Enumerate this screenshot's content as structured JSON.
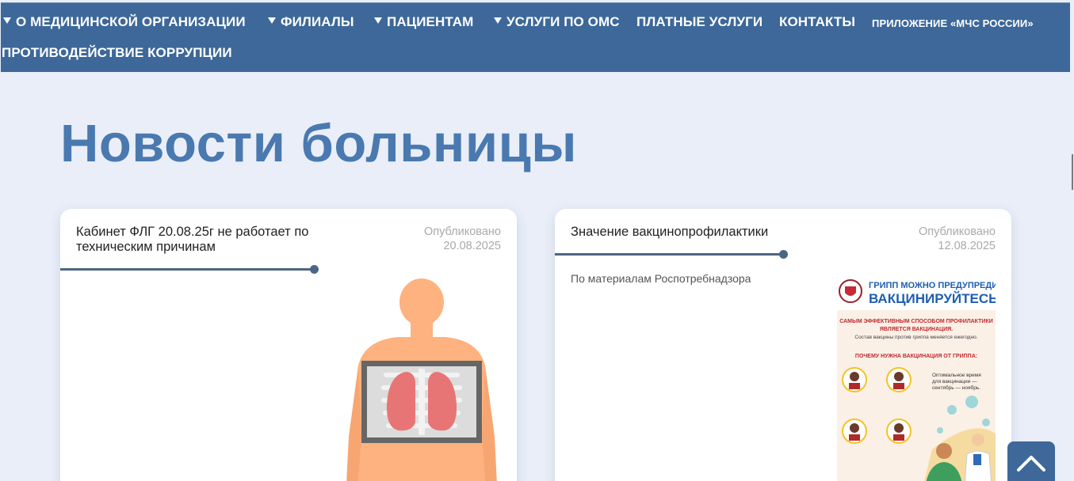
{
  "nav": {
    "items": [
      {
        "label": "О МЕДИЦИНСКОЙ ОРГАНИЗАЦИИ",
        "dropdown": true
      },
      {
        "label": "ФИЛИАЛЫ",
        "dropdown": true
      },
      {
        "label": "ПАЦИЕНТАМ",
        "dropdown": true
      },
      {
        "label": "УСЛУГИ ПО ОМС",
        "dropdown": true
      },
      {
        "label": "ПЛАТНЫЕ УСЛУГИ",
        "dropdown": false
      },
      {
        "label": "КОНТАКТЫ",
        "dropdown": false
      },
      {
        "label": "ПРИЛОЖЕНИЕ «МЧС РОССИИ»",
        "dropdown": false
      },
      {
        "label": "ПРОТИВОДЕЙСТВИЕ КОРРУПЦИИ",
        "dropdown": false
      }
    ]
  },
  "page": {
    "title": "Новости больницы"
  },
  "news": [
    {
      "title": "Кабинет ФЛГ 20.08.25г не работает по техническим причинам",
      "published_label": "Опубликовано",
      "date": "20.08.2025",
      "excerpt": "",
      "image": "chest-xray-illustration"
    },
    {
      "title": "Значение вакцинопрофилактики",
      "published_label": "Опубликовано",
      "date": "12.08.2025",
      "excerpt": "По материалам Роспотребнадзора",
      "image": "flu-vaccination-poster"
    }
  ],
  "poster": {
    "line1": "ГРИПП МОЖНО ПРЕДУПРЕДИТЬ!",
    "line2": "ВАКЦИНИРУЙТЕСЬ!",
    "line3": "САМЫМ ЭФФЕКТИВНЫМ СПОСОБОМ ПРОФИЛАКТИКИ",
    "line4": "ЯВЛЯЕТСЯ ВАКЦИНАЦИЯ.",
    "line5": "Состав вакцины против гриппа меняется ежегодно.",
    "line6": "ПОЧЕМУ НУЖНА ВАКЦИНАЦИЯ ОТ ГРИППА:",
    "line7": "Оптимальное время",
    "line8": "для вакцинации —",
    "line9": "сентябрь — ноябрь."
  },
  "icons": {
    "scroll_top": "chevron-up-icon",
    "dropdown": "triangle-down-icon"
  },
  "colors": {
    "nav_bg": "#3d6899",
    "title": "#4a79b0",
    "page_bg": "#e9eef8",
    "accent_line": "#4d6585"
  }
}
